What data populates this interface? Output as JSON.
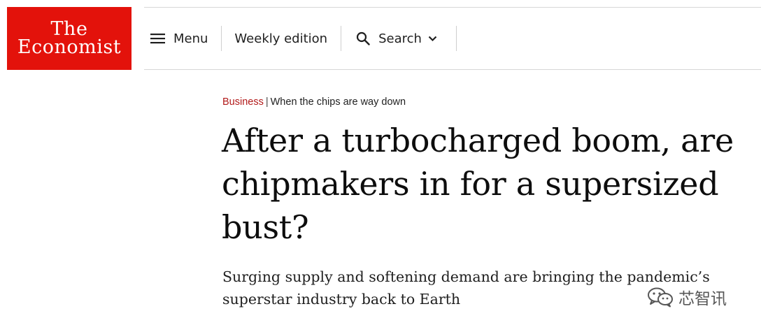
{
  "brand": {
    "line1": "The",
    "line2": "Economist",
    "color": "#e3120b"
  },
  "nav": {
    "menu_label": "Menu",
    "weekly_label": "Weekly edition",
    "search_label": "Search"
  },
  "article": {
    "section": "Business",
    "separator": "|",
    "rubric": "When the chips are way down",
    "headline": "After a turbocharged boom, are chipmakers in for a supersized bust?",
    "standfirst": "Surging supply and softening demand are bringing the pandemic’s superstar industry back to Earth",
    "section_color": "#b21a1a"
  },
  "watermark": {
    "text": "芯智讯",
    "icon": "wechat-icon"
  }
}
